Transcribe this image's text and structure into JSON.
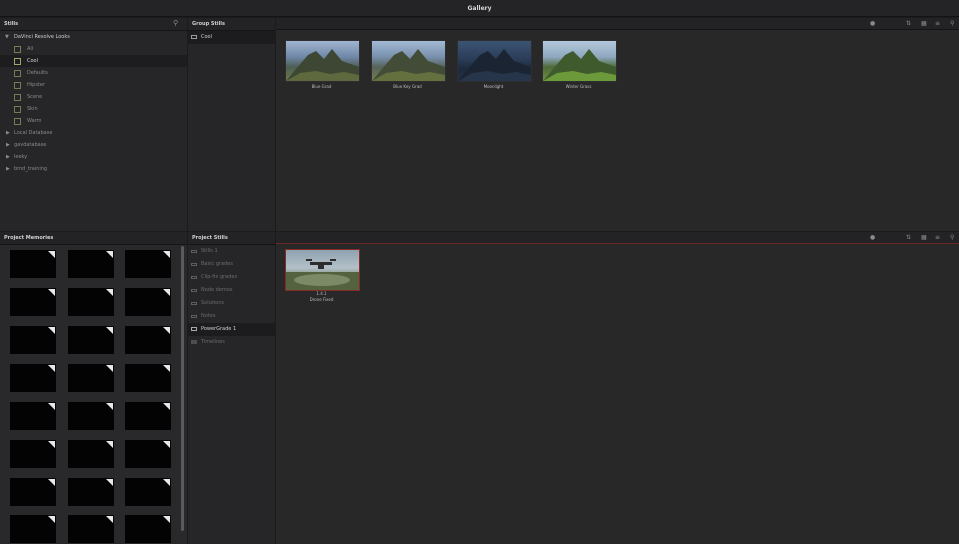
{
  "title": "Gallery",
  "stills_panel": {
    "header": "Stills",
    "items": [
      {
        "label": "DaVinci Resolve Looks",
        "type": "group-open"
      },
      {
        "label": "All",
        "type": "album"
      },
      {
        "label": "Cool",
        "type": "album",
        "selected": true
      },
      {
        "label": "Defaults",
        "type": "album"
      },
      {
        "label": "Hipster",
        "type": "album"
      },
      {
        "label": "Scene",
        "type": "album"
      },
      {
        "label": "Skin",
        "type": "album"
      },
      {
        "label": "Warm",
        "type": "album"
      },
      {
        "label": "Local Database",
        "type": "group"
      },
      {
        "label": "gavdatabase",
        "type": "group"
      },
      {
        "label": "leeky",
        "type": "group"
      },
      {
        "label": "bmd_training",
        "type": "group"
      }
    ]
  },
  "group_stills": {
    "header": "Group Stills",
    "album": "Cool",
    "thumbnails": [
      {
        "caption": "Blue Grad"
      },
      {
        "caption": "Blue Key Grad"
      },
      {
        "caption": "Moonlight"
      },
      {
        "caption": "Winter Grass"
      }
    ]
  },
  "project_memories": {
    "header": "Project Memories"
  },
  "project_stills": {
    "header": "Project Stills",
    "albums": [
      {
        "label": "Stills 1"
      },
      {
        "label": "Basic grades"
      },
      {
        "label": "Clip-fix grades"
      },
      {
        "label": "Node demos"
      },
      {
        "label": "Solutions"
      },
      {
        "label": "Notes"
      },
      {
        "label": "PowerGrade 1",
        "selected": true
      },
      {
        "label": "Timelines"
      }
    ],
    "thumbnail": {
      "index": "1.4.1",
      "caption": "Drone Fixed"
    }
  },
  "colors": {
    "accent": "#8a2a25",
    "background": "#1b1b1d",
    "panel": "#262628"
  }
}
